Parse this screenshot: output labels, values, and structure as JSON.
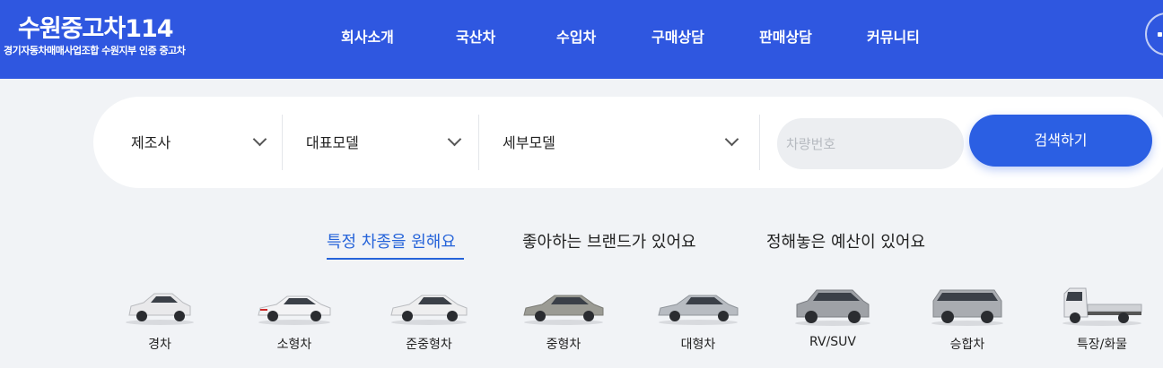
{
  "header": {
    "logo_title": "수원중고차114",
    "logo_subtitle": "경기자동차매매사업조합 수원지부 인증 중고차",
    "nav": [
      "회사소개",
      "국산차",
      "수입차",
      "구매상담",
      "판매상담",
      "커뮤니티"
    ]
  },
  "search": {
    "maker": "제조사",
    "model": "대표모델",
    "submodel": "세부모델",
    "plate_placeholder": "차량번호",
    "button": "검색하기"
  },
  "tabs": [
    "특정 차종을 원해요",
    "좋아하는 브랜드가 있어요",
    "정해놓은 예산이 있어요"
  ],
  "categories": [
    {
      "label": "경차",
      "icon": "light-car-icon",
      "color": "#e9e9eb"
    },
    {
      "label": "소형차",
      "icon": "small-car-icon",
      "color": "#f3f3f5"
    },
    {
      "label": "준중형차",
      "icon": "compact-car-icon",
      "color": "#eeeeef"
    },
    {
      "label": "중형차",
      "icon": "midsize-car-icon",
      "color": "#9b9b94"
    },
    {
      "label": "대형차",
      "icon": "large-car-icon",
      "color": "#b8bcc2"
    },
    {
      "label": "RV/SUV",
      "icon": "suv-icon",
      "color": "#9ea1a6"
    },
    {
      "label": "승합차",
      "icon": "van-icon",
      "color": "#a9acb1"
    },
    {
      "label": "특장/화물",
      "icon": "truck-icon",
      "color": "#e6e7ea"
    }
  ],
  "colors": {
    "header": "#2f57e0",
    "accent": "#2563d9",
    "button": "#2b5fe3"
  }
}
